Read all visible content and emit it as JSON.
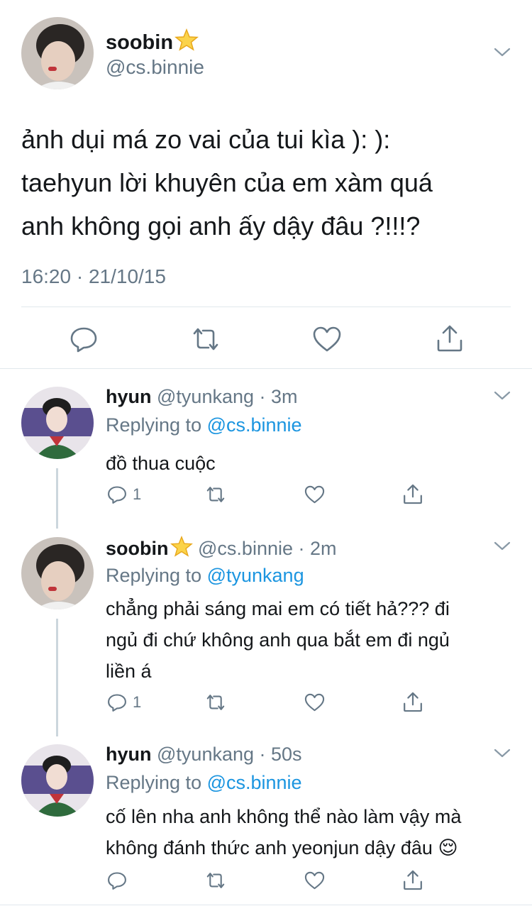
{
  "main_tweet": {
    "display_name": "soobin",
    "handle": "@cs.binnie",
    "text_lines": [
      "ảnh dụi má zo vai của tui kìa ): ):",
      "taehyun lời khuyên của em xàm quá",
      "anh không gọi anh ấy dậy đâu ?!!!?"
    ],
    "timestamp": "16:20 · 21/10/15",
    "name_emoji": "star-icon"
  },
  "replies": [
    {
      "display_name": "hyun",
      "handle": "@tyunkang",
      "time": "· 3m",
      "replying_label": "Replying to ",
      "replying_to": "@cs.binnie",
      "text_lines": [
        "đồ thua cuộc"
      ],
      "reply_count": "1"
    },
    {
      "display_name": "soobin",
      "handle": "@cs.binnie",
      "time": "· 2m",
      "replying_label": "Replying to ",
      "replying_to": "@tyunkang",
      "text_lines": [
        "chẳng phải sáng mai em có tiết hả??? đi",
        "ngủ đi chứ không anh qua bắt em đi ngủ",
        "liền á"
      ],
      "reply_count": "1"
    },
    {
      "display_name": "hyun",
      "handle": "@tyunkang",
      "time": "· 50s",
      "replying_label": "Replying to ",
      "replying_to": "@cs.binnie",
      "text_lines": [
        "cố lên nha anh không thể nào làm vậy mà",
        "không đánh thức anh yeonjun dậy đâu 😌"
      ],
      "reply_count": ""
    }
  ],
  "colors": {
    "text": "#14171a",
    "secondary": "#657786",
    "link": "#1b95e0",
    "divider": "#e1e8ed"
  }
}
